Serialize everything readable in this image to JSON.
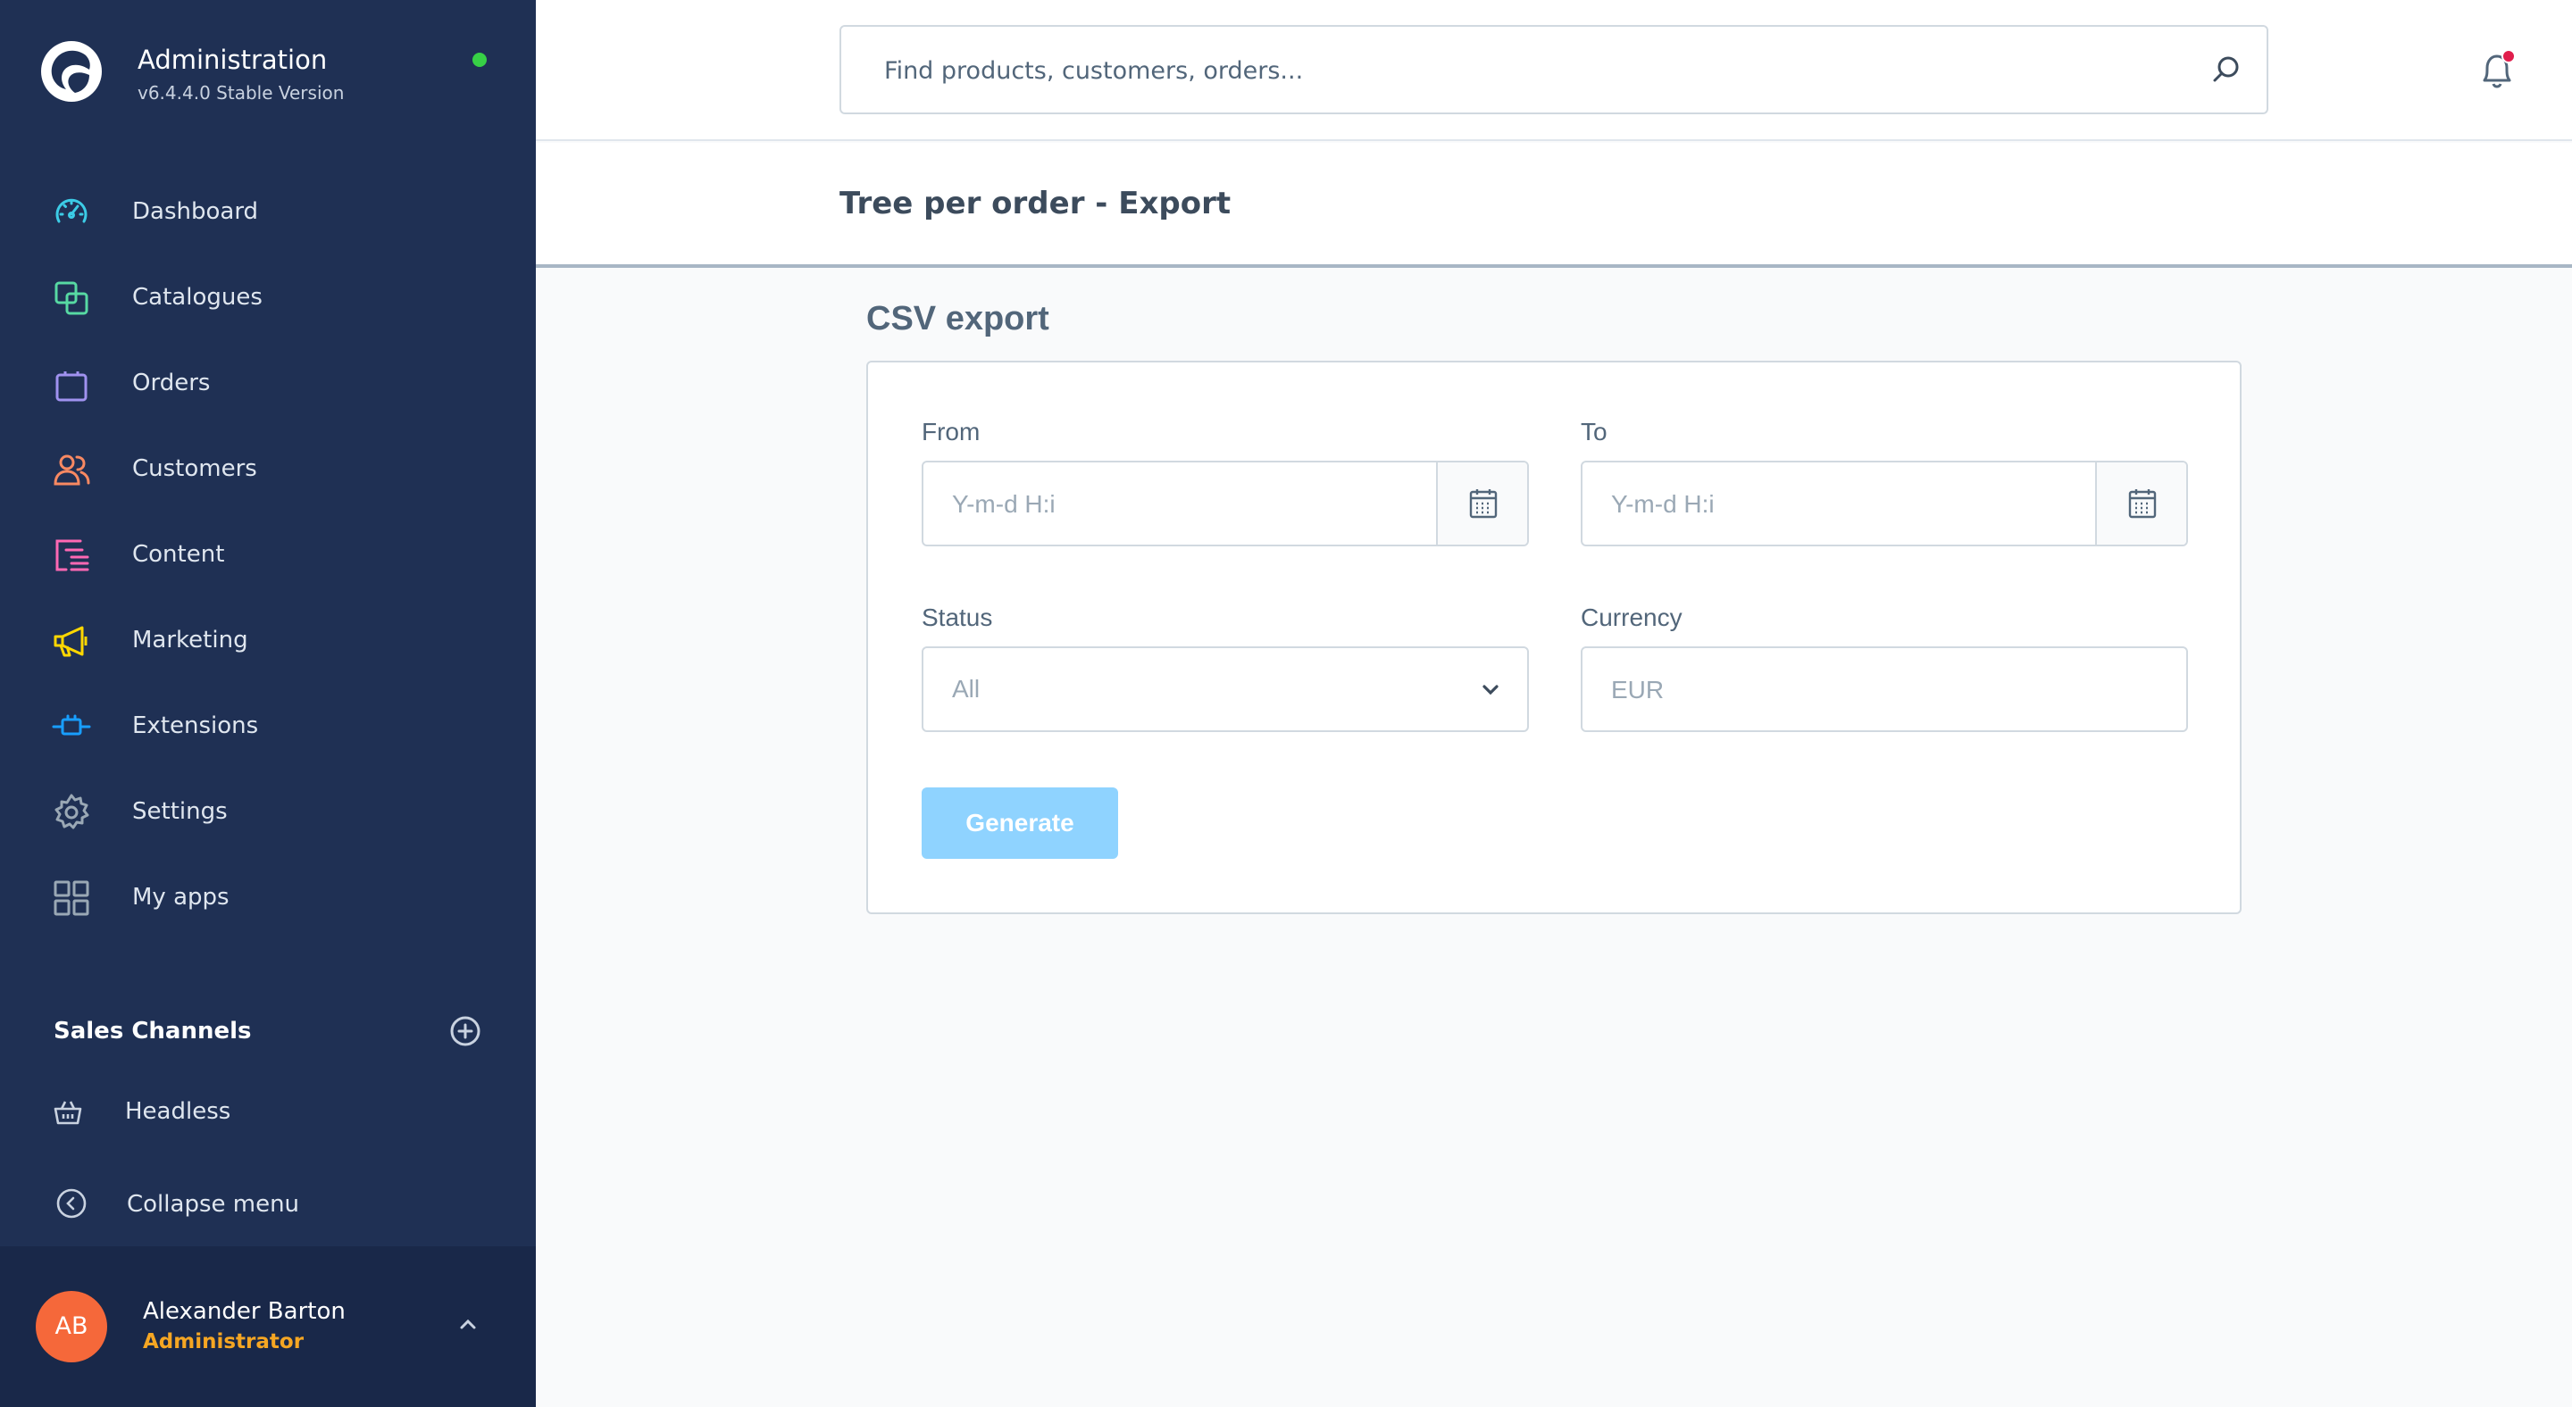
{
  "brand": {
    "title": "Administration",
    "version": "v6.4.4.0 Stable Version",
    "status_color": "#37d046"
  },
  "nav": {
    "items": [
      {
        "label": "Dashboard",
        "icon": "gauge-icon",
        "color": "#3ccce6"
      },
      {
        "label": "Catalogues",
        "icon": "catalogue-icon",
        "color": "#57d9a3"
      },
      {
        "label": "Orders",
        "icon": "shopping-bag-icon",
        "color": "#a092f0"
      },
      {
        "label": "Customers",
        "icon": "users-icon",
        "color": "#f88962"
      },
      {
        "label": "Content",
        "icon": "content-icon",
        "color": "#ff68b4"
      },
      {
        "label": "Marketing",
        "icon": "megaphone-icon",
        "color": "#ffd700"
      },
      {
        "label": "Extensions",
        "icon": "plug-icon",
        "color": "#189eff"
      },
      {
        "label": "Settings",
        "icon": "gear-icon",
        "color": "#9aa8b5"
      },
      {
        "label": "My apps",
        "icon": "apps-grid-icon",
        "color": "#9aa8b5"
      }
    ]
  },
  "sales_channels": {
    "title": "Sales Channels",
    "items": [
      {
        "label": "Headless",
        "icon": "basket-icon"
      }
    ]
  },
  "collapse": {
    "label": "Collapse menu"
  },
  "user": {
    "initials": "AB",
    "name": "Alexander Barton",
    "role": "Administrator",
    "avatar_color": "#f5683a"
  },
  "search": {
    "placeholder": "Find products, customers, orders..."
  },
  "notifications": {
    "indicator_color": "#e01e4c"
  },
  "page": {
    "title": "Tree per order - Export"
  },
  "export": {
    "section_title": "CSV export",
    "from": {
      "label": "From",
      "placeholder": "Y-m-d H:i"
    },
    "to": {
      "label": "To",
      "placeholder": "Y-m-d H:i"
    },
    "status": {
      "label": "Status",
      "selected": "All"
    },
    "currency": {
      "label": "Currency",
      "placeholder": "EUR"
    },
    "generate_label": "Generate",
    "button_color": "#8fd3ff"
  }
}
